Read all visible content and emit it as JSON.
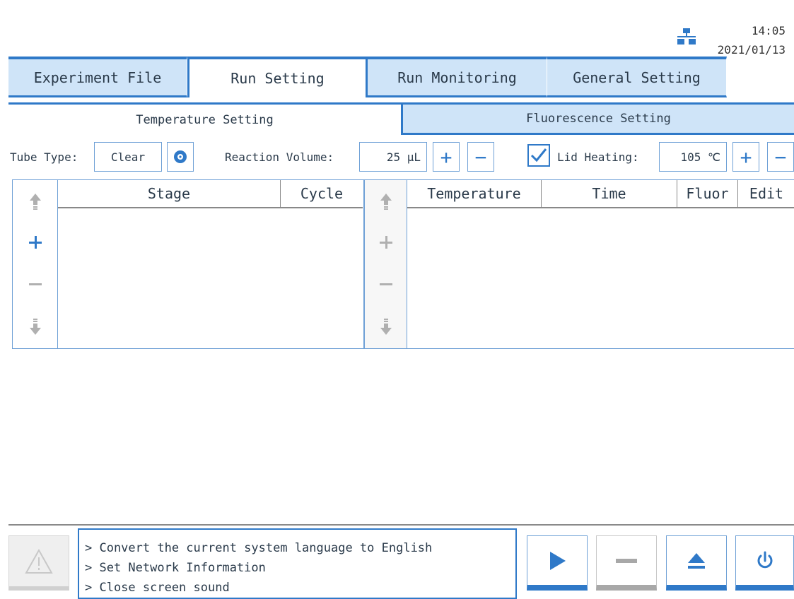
{
  "header": {
    "time": "14:05",
    "date": "2021/01/13",
    "network_icon": "network-icon"
  },
  "main_tabs": [
    {
      "label": "Experiment File",
      "active": false
    },
    {
      "label": "Run Setting",
      "active": true
    },
    {
      "label": "Run Monitoring",
      "active": false
    },
    {
      "label": "General Setting",
      "active": false
    }
  ],
  "sub_tabs": [
    {
      "label": "Temperature Setting",
      "active": true
    },
    {
      "label": "Fluorescence Setting",
      "active": false
    }
  ],
  "settings": {
    "tube_type_label": "Tube Type:",
    "tube_type_value": "Clear",
    "reaction_volume_label": "Reaction Volume:",
    "reaction_volume_value": "25 µL",
    "lid_heating_checked": true,
    "lid_heating_label": "Lid Heating:",
    "lid_heating_value": "105 ℃"
  },
  "stage_table": {
    "columns": [
      "Stage",
      "Cycle"
    ],
    "rows": []
  },
  "step_table": {
    "columns": [
      "Temperature",
      "Time",
      "Fluor",
      "Edit"
    ],
    "rows": []
  },
  "messages": [
    "> Convert the current system language to English",
    "> Set Network Information",
    "> Close screen sound"
  ],
  "colors": {
    "accent": "#2f79c8",
    "tab_inactive": "#cfe4f8",
    "border": "#6ea0d6",
    "disabled": "#a8a8a8"
  }
}
